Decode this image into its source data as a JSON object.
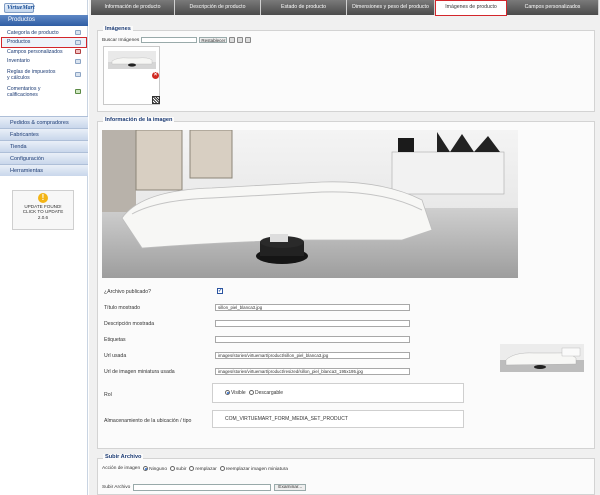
{
  "app": {
    "logo": "VirtueMart"
  },
  "sidebar": {
    "header": "Productos",
    "items": [
      {
        "label": "Categoría de producto",
        "icon": "folder-icon"
      },
      {
        "label": "Productos",
        "icon": "products-icon",
        "selected": true
      },
      {
        "label": "Campos personalizados",
        "icon": "custom-fields-icon"
      },
      {
        "label": "Inventario",
        "icon": "inventory-icon"
      },
      {
        "label": "Reglas de impuestos y cálculos",
        "icon": "calc-icon"
      },
      {
        "label": "Comentarios y calificaciones",
        "icon": "comments-icon"
      }
    ],
    "menu": [
      "Pedidos & compradores",
      "Fabricantes",
      "Tienda",
      "Configuración",
      "Herramientas"
    ],
    "update": {
      "line1": "UPDATE FOUND!",
      "line2": "CLICK TO UPDATE",
      "line3": "2.0.6"
    }
  },
  "tabs": [
    {
      "label": "Información de producto"
    },
    {
      "label": "Descripción de producto"
    },
    {
      "label": "Estado de producto"
    },
    {
      "label": "Dimensiones y peso del producto"
    },
    {
      "label": "Imágenes de producto",
      "active": true
    },
    {
      "label": "Campos personalizados"
    }
  ],
  "images": {
    "legend": "Imágenes",
    "search_label": "Buscar Imágenes",
    "search_value": "",
    "reset_label": "Restablecer"
  },
  "info": {
    "legend": "Información de la imagen",
    "published_label": "¿Archivo publicado?",
    "published": true,
    "title_label": "Título mostrado",
    "title_value": "sillon_piel_blanca3.jpg",
    "desc_label": "Descripción mostrada",
    "desc_value": "",
    "tags_label": "Etiquetas",
    "tags_value": "",
    "url_label": "Url usada",
    "url_value": "images/stories/virtuemart/product/sillon_piel_blanca3.jpg",
    "thumb_url_label": "Url de imagen miniatura usada",
    "thumb_url_value": "images/stories/virtuemart/product/resized/sillon_piel_blanca3_195x195.jpg",
    "role_label": "Rol",
    "role_options": [
      "Visible",
      "Descargable"
    ],
    "role_selected": "Visible",
    "storage_label": "Almacenamiento de la ubicación / tipo",
    "storage_value": "COM_VIRTUEMART_FORM_MEDIA_SET_PRODUCT"
  },
  "upload": {
    "legend": "Subir Archivo",
    "action_label": "Acción de imagen",
    "actions": [
      "Ninguno",
      "subir",
      "remplazar",
      "reemplazar imagen miniatura"
    ],
    "action_selected": "Ninguno",
    "file_label": "Subir Archivo",
    "browse_label": "Examinar..."
  },
  "colors": {
    "accent": "#d3262b",
    "sidebar_blue": "#2f5da3",
    "tab_dark": "#4a4a4a"
  }
}
